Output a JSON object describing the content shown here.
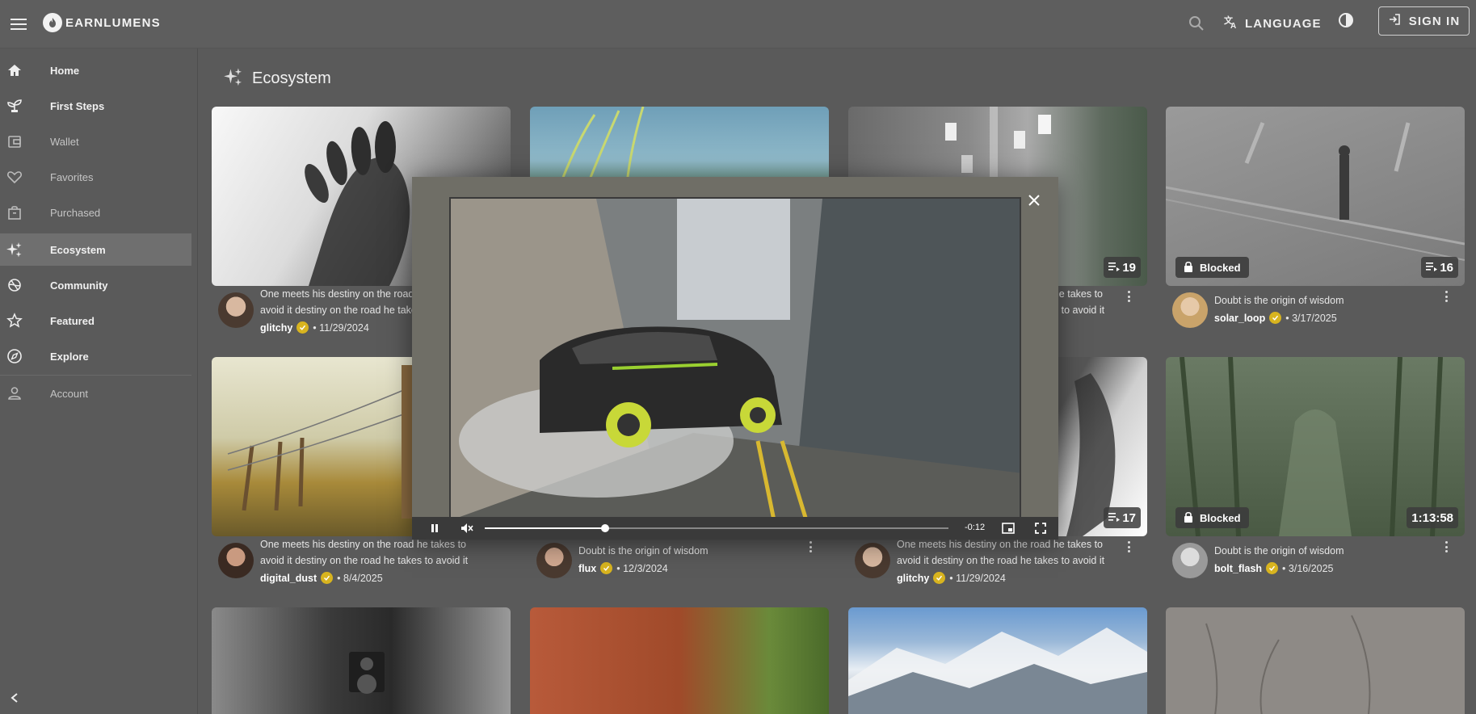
{
  "header": {
    "brand": "EARNLUMENS",
    "language_label": "LANGUAGE",
    "signin_label": "SIGN IN"
  },
  "sidebar": {
    "items": [
      {
        "label": "Home",
        "icon": "home-icon"
      },
      {
        "label": "First Steps",
        "icon": "plant-icon"
      },
      {
        "label": "Wallet",
        "icon": "wallet-icon"
      },
      {
        "label": "Favorites",
        "icon": "heart-icon"
      },
      {
        "label": "Purchased",
        "icon": "bag-icon"
      },
      {
        "label": "Ecosystem",
        "icon": "sparkle-icon",
        "active": true
      },
      {
        "label": "Community",
        "icon": "community-icon"
      },
      {
        "label": "Featured",
        "icon": "star-icon"
      },
      {
        "label": "Explore",
        "icon": "compass-icon"
      },
      {
        "label": "Account",
        "icon": "person-icon"
      }
    ]
  },
  "main": {
    "title": "Ecosystem",
    "cards": [
      {
        "desc": "One meets his destiny on the road he takes to avoid it destiny on the road he takes to avoid it",
        "user": "glitchy",
        "date": "• 11/29/2024"
      },
      {
        "desc": "",
        "user": "",
        "date": ""
      },
      {
        "desc": "One meets his destiny on the road he takes to avoid it destiny on the road he takes to avoid it",
        "user": "",
        "date": "",
        "count": "19"
      },
      {
        "desc": "Doubt is the origin of wisdom",
        "user": "solar_loop",
        "date": "• 3/17/2025",
        "blocked": "Blocked",
        "count": "16"
      },
      {
        "desc": "One meets his destiny on the road he takes to avoid it destiny on the road he takes to avoid it",
        "user": "digital_dust",
        "date": "• 8/4/2025"
      },
      {
        "desc": "Doubt is the origin of wisdom",
        "user": "flux",
        "date": "• 12/3/2024"
      },
      {
        "desc": "One meets his destiny on the road he takes to avoid it destiny on the road he takes to avoid it",
        "user": "glitchy",
        "date": "• 11/29/2024",
        "count": "17"
      },
      {
        "desc": "Doubt is the origin of wisdom",
        "user": "bolt_flash",
        "date": "• 3/16/2025",
        "blocked": "Blocked",
        "duration": "1:13:58"
      }
    ]
  },
  "player": {
    "time_remaining": "-0:12",
    "progress": 0.26
  },
  "colors": {
    "background": "#5a5a5a",
    "verified": "#d8b41f",
    "active_nav": "#6f6f6f"
  }
}
